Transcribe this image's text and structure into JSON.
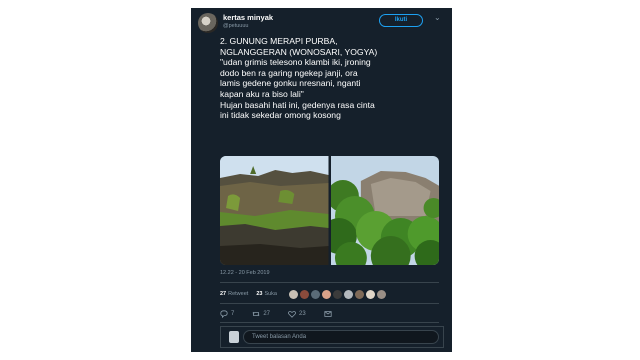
{
  "tweet": {
    "author_name": "kertas minyak",
    "author_handle": "@petuuuu",
    "follow_label": "Ikuti",
    "text_lines": [
      "2. GUNUNG MERAPI PURBA,",
      "NGLANGGERAN (WONOSARI, YOGYA)",
      "\"udan grimis telesono klambi iki, jroning",
      "dodo ben ra garing ngekep janji, ora",
      "lamis gedene gonku nresnani, nganti",
      "kapan aku ra biso lali\"",
      "Hujan basahi hati ini, gedenya rasa cinta",
      "ini tidak sekedar omong kosong"
    ],
    "timestamp": "12.22 - 20 Feb 2019",
    "retweet_count": "27",
    "retweet_label": "Retweet",
    "like_count": "23",
    "like_label": "Suka",
    "liker_colors": [
      "#c8c0b5",
      "#8a4b3c",
      "#5a6b78",
      "#d9a28a",
      "#3b3b3b",
      "#b3b8bd",
      "#7f6a58",
      "#e0d6c8",
      "#9a8f86"
    ],
    "actions": {
      "reply_count": "7",
      "retweet_count": "27",
      "like_count": "23"
    },
    "reply_placeholder": "Tweet balasan Anda"
  },
  "colors": {
    "background": "#15202b",
    "accent": "#1da1f2",
    "muted": "#8899a6",
    "divider": "#38444d"
  }
}
